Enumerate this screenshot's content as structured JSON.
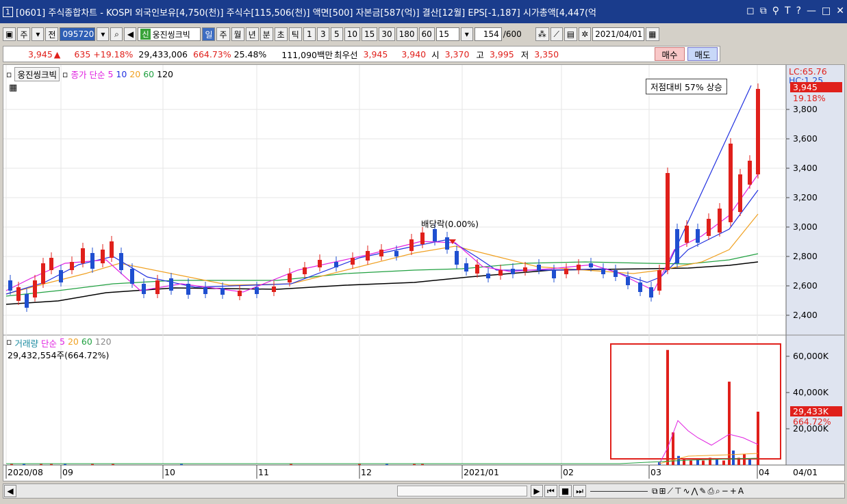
{
  "window": {
    "number": "1",
    "title": "[0601] 주식종합차트 - KOSPI 외국인보유[4,750(천)] 주식수[115,506(천)] 액면[500] 자본금[587(억)] 결산[12월] EPS[-1,187] 시가총액[4,447(억"
  },
  "toolbar": {
    "market": "주",
    "type": "전",
    "code": "095720",
    "new_badge": "신",
    "stock_name": "웅진씽크빅",
    "periods": [
      "일",
      "주",
      "월",
      "년",
      "분",
      "초",
      "틱"
    ],
    "intervals": [
      "1",
      "3",
      "5",
      "10",
      "15",
      "30",
      "180",
      "60"
    ],
    "interval_value": "15",
    "count": "154",
    "count_max": "/600",
    "date": "2021/04/01"
  },
  "quote": {
    "price": "3,945",
    "change": "635",
    "change_pct": "+19.18%",
    "volume": "29,433,006",
    "volume_pct": "664.73%",
    "turnover": "25.48%",
    "amount": "111,090백만",
    "best_label": "최우선",
    "ask": "3,945",
    "bid": "3,940",
    "open_label": "시",
    "open": "3,370",
    "high_label": "고",
    "high": "3,995",
    "low_label": "저",
    "low": "3,350",
    "buy_label": "매수",
    "sell_label": "매도"
  },
  "price_panel": {
    "stock": "웅진씽크빅",
    "ma_label": "종가 단순",
    "ma_periods": [
      "5",
      "10",
      "20",
      "60",
      "120"
    ],
    "note": "저점대비 57% 상승",
    "dividend_label": "배당락(0.00%)",
    "lc": "LC:65.76",
    "hc": "HC:1.25",
    "last_price": "3,945",
    "last_pct": "19.18%",
    "axis": [
      "3,800",
      "3,600",
      "3,400",
      "3,200",
      "3,000",
      "2,800",
      "2,600",
      "2,400"
    ]
  },
  "volume_panel": {
    "label": "거래량",
    "ma_label": "단순",
    "ma_periods": [
      "5",
      "20",
      "60",
      "120"
    ],
    "info": "29,432,554주(664.72%)",
    "axis": [
      "60,000K",
      "40,000K",
      "20,000K"
    ],
    "last_volume": "29,433K",
    "last_pct": "664.72%"
  },
  "x_axis": [
    "2020/08",
    "09",
    "10",
    "11",
    "12",
    "2021/01",
    "02",
    "03",
    "04"
  ],
  "x_axis_right": "04/01",
  "colors": {
    "up": "#e0201b",
    "down": "#1f4fd0",
    "ma5": "#e020e0",
    "ma10": "#2030e0",
    "ma20": "#f0a020",
    "ma60": "#20a040",
    "ma120": "#000000"
  }
}
